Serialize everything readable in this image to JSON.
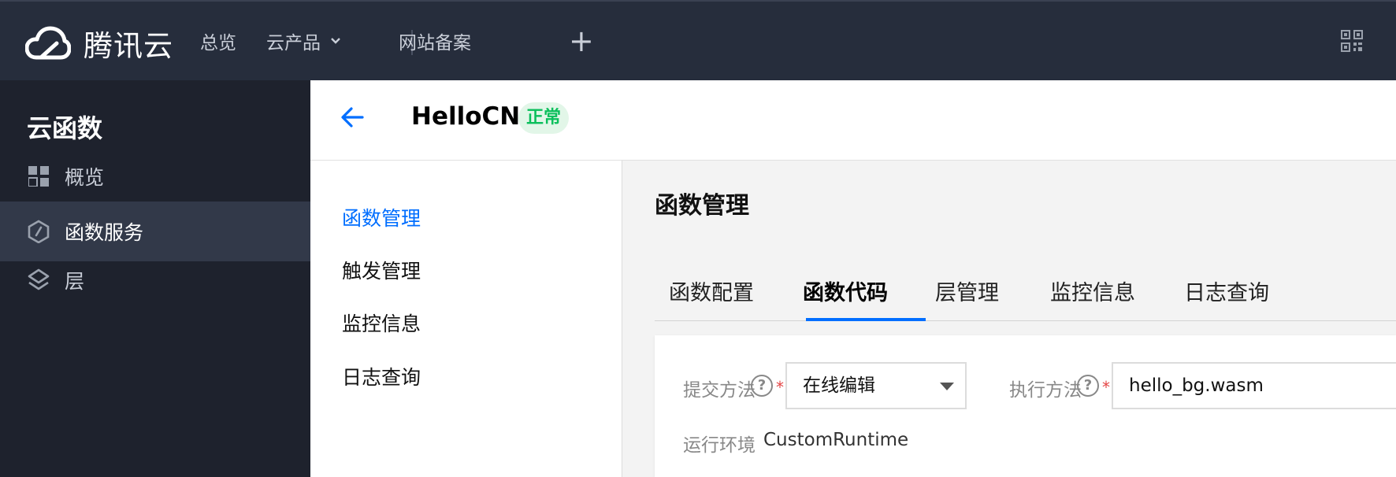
{
  "topbar": {
    "logo_text": "腾讯云",
    "nav": [
      "总览",
      "云产品",
      "网站备案"
    ],
    "plus": "+"
  },
  "sidebar": {
    "title": "云函数",
    "items": [
      {
        "label": "概览",
        "icon": "grid-icon"
      },
      {
        "label": "函数服务",
        "icon": "hexagon-function-icon"
      },
      {
        "label": "层",
        "icon": "layers-icon"
      }
    ]
  },
  "header": {
    "function_name": "HelloCN",
    "status": "正常"
  },
  "subnav": [
    "函数管理",
    "触发管理",
    "监控信息",
    "日志查询"
  ],
  "content": {
    "title": "函数管理",
    "tabs": [
      "函数配置",
      "函数代码",
      "层管理",
      "监控信息",
      "日志查询"
    ],
    "active_tab": "函数代码",
    "form": {
      "submit_method_label": "提交方法",
      "submit_method_value": "在线编辑",
      "exec_method_label": "执行方法",
      "exec_method_value": "hello_bg.wasm",
      "runtime_label": "运行环境",
      "runtime_value": "CustomRuntime",
      "help_glyph": "?",
      "required_mark": "*"
    }
  },
  "colors": {
    "topbar_bg": "#262d3c",
    "sidebar_bg": "#1e222d",
    "accent": "#006eff",
    "status_green": "#0abf5b"
  }
}
